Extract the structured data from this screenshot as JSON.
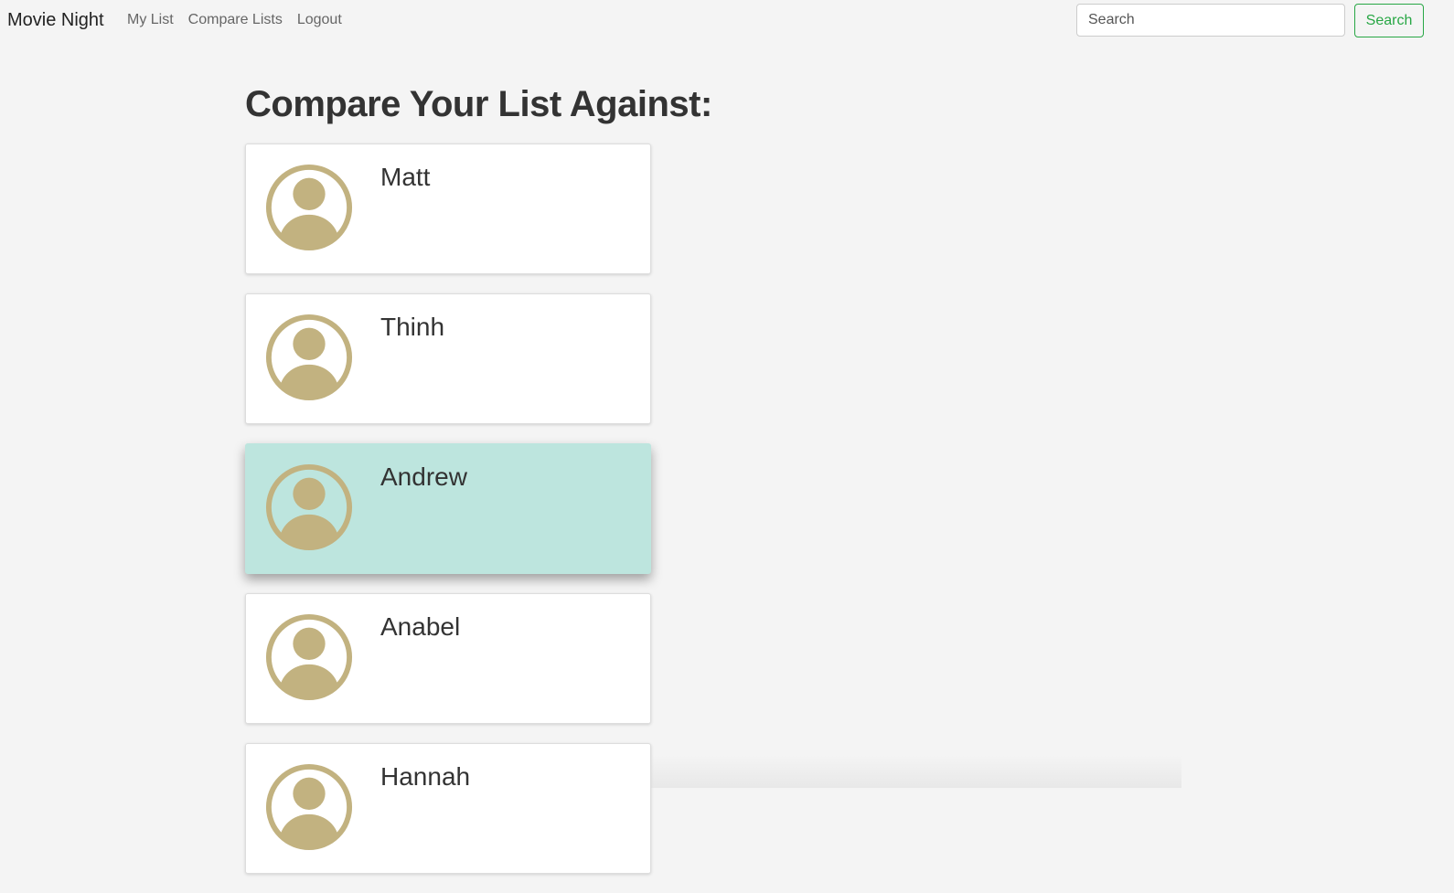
{
  "navbar": {
    "brand": "Movie Night",
    "links": [
      "My List",
      "Compare Lists",
      "Logout"
    ],
    "search": {
      "placeholder": "Search",
      "button_label": "Search"
    }
  },
  "main": {
    "title": "Compare Your List Against:",
    "users": [
      {
        "name": "Matt",
        "active": false
      },
      {
        "name": "Thinh",
        "active": false
      },
      {
        "name": "Andrew",
        "active": true
      },
      {
        "name": "Anabel",
        "active": false
      },
      {
        "name": "Hannah",
        "active": false
      }
    ]
  },
  "colors": {
    "background": "#f4f4f4",
    "card": "#ffffff",
    "card_active": "#bde5de",
    "avatar": "#c2b280",
    "success": "#28a745"
  },
  "icons": {
    "avatar": "user-circle-icon"
  }
}
